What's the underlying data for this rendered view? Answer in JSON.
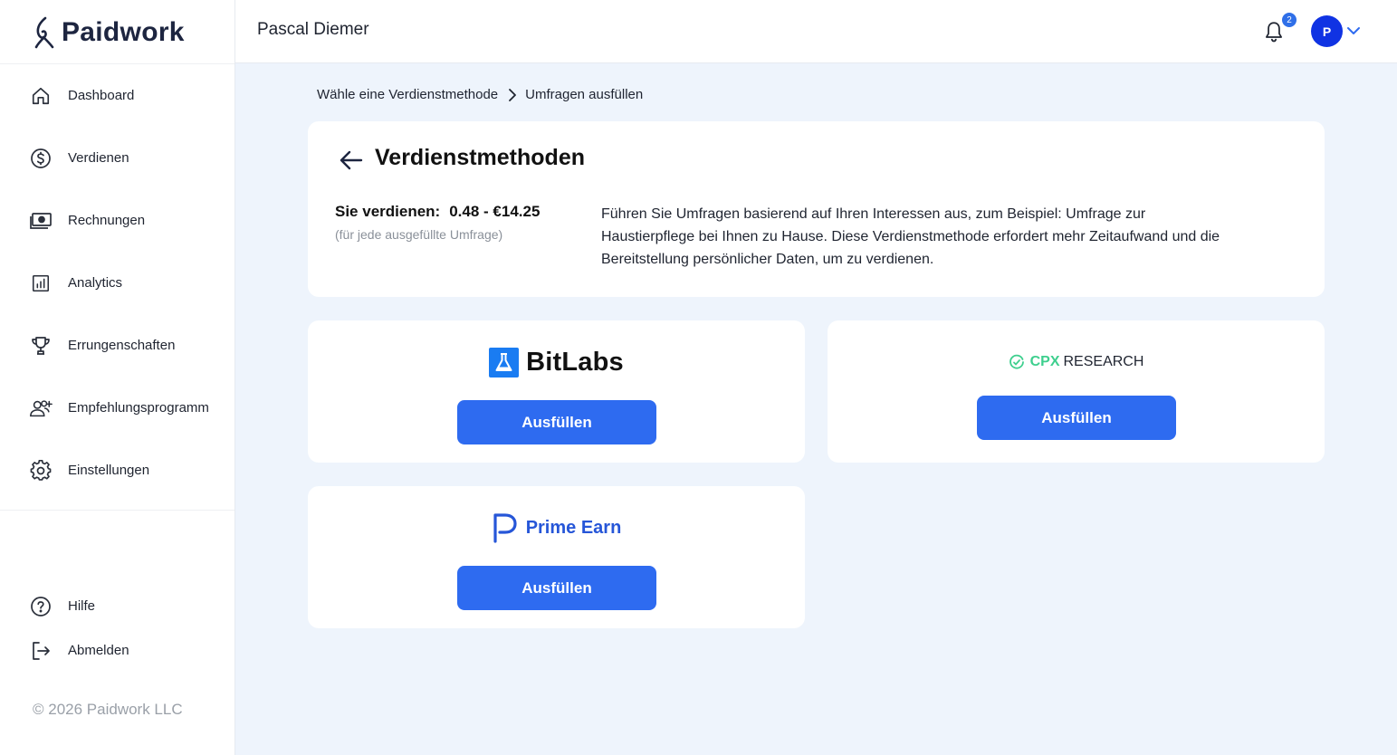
{
  "app": {
    "logo_text": "Paidwork",
    "copyright": "© 2026 Paidwork LLC"
  },
  "sidebar": {
    "items": [
      {
        "label": "Dashboard",
        "icon": "home-icon"
      },
      {
        "label": "Verdienen",
        "icon": "dollar-icon"
      },
      {
        "label": "Rechnungen",
        "icon": "money-icon"
      },
      {
        "label": "Analytics",
        "icon": "chart-icon"
      },
      {
        "label": "Errungenschaften",
        "icon": "trophy-icon"
      },
      {
        "label": "Empfehlungsprogramm",
        "icon": "user-add-icon"
      },
      {
        "label": "Einstellungen",
        "icon": "gear-icon"
      }
    ],
    "bottom_items": [
      {
        "label": "Hilfe",
        "icon": "help-icon"
      },
      {
        "label": "Abmelden",
        "icon": "logout-icon"
      }
    ]
  },
  "header": {
    "user_name": "Pascal Diemer",
    "notification_count": "2",
    "avatar_initial": "P"
  },
  "breadcrumb": {
    "items": [
      "Wähle eine Verdienstmethode",
      "Umfragen ausfüllen"
    ]
  },
  "info": {
    "title": "Verdienstmethoden",
    "earn_label": "Sie verdienen:",
    "earn_value": "0.48 - €14.25",
    "earn_sub": "(für jede ausgefüllte Umfrage)",
    "description": "Führen Sie Umfragen basierend auf Ihren Interessen aus, zum Beispiel: Umfrage zur Haustierpflege bei Ihnen zu Hause. Diese Verdienstmethode erfordert mehr Zeitaufwand und die Bereitstellung persönlicher Daten, um zu verdienen."
  },
  "providers": [
    {
      "name": "BitLabs",
      "button_label": "Ausfüllen"
    },
    {
      "name_a": "CPX",
      "name_b": "RESEARCH",
      "button_label": "Ausfüllen"
    },
    {
      "name": "Prime Earn",
      "button_label": "Ausfüllen"
    }
  ],
  "colors": {
    "accent": "#2e6bf0",
    "avatar": "#1033e3",
    "background": "#eef4fc",
    "cpx_green": "#3ecf8e"
  }
}
